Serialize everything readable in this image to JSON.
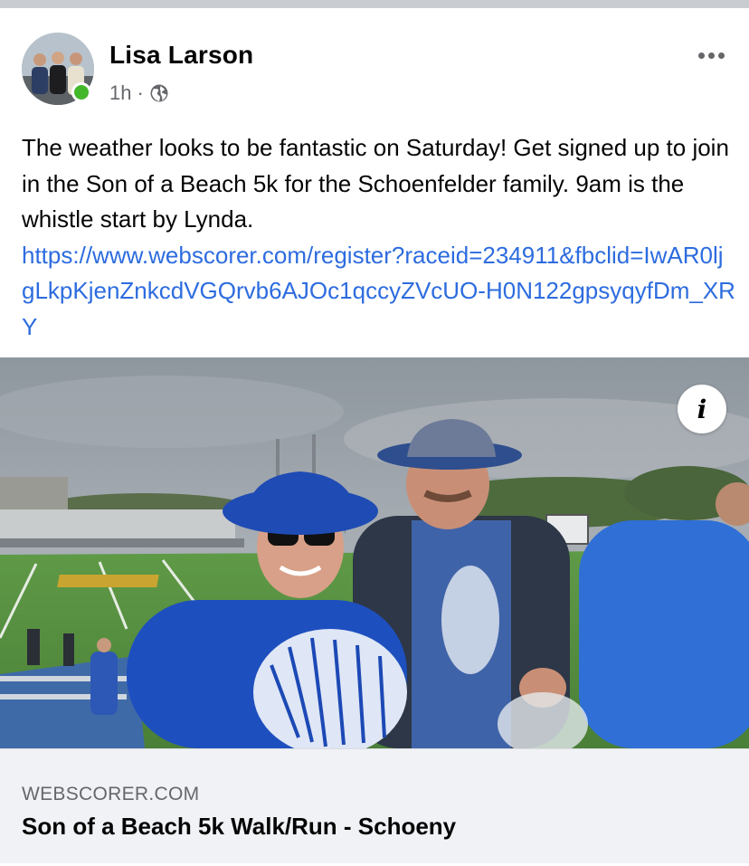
{
  "post": {
    "author": "Lisa Larson",
    "time": "1h",
    "separator": "·",
    "audience_icon": "globe-icon",
    "more_icon": "more-options-icon",
    "text": "The weather looks to be fantastic on Saturday! Get signed up to join in the Son of a Beach 5k for the Schoenfelder family. 9am is the whistle start by Lynda.",
    "link": "https://www.webscorer.com/register?raceid=234911&fbclid=IwAR0ljgLkpKjenZnkcdVGQrvb6AJOc1qccyZVcUO-H0N122gpsyqyfDm_XRY"
  },
  "image": {
    "info_label": "i"
  },
  "preview": {
    "domain": "WEBSCORER.COM",
    "title": "Son of a Beach 5k Walk/Run - Schoeny"
  },
  "colors": {
    "link": "#2d6cdf",
    "online": "#42b72a",
    "secondary_text": "#65676b",
    "preview_bg": "#f0f2f5"
  }
}
